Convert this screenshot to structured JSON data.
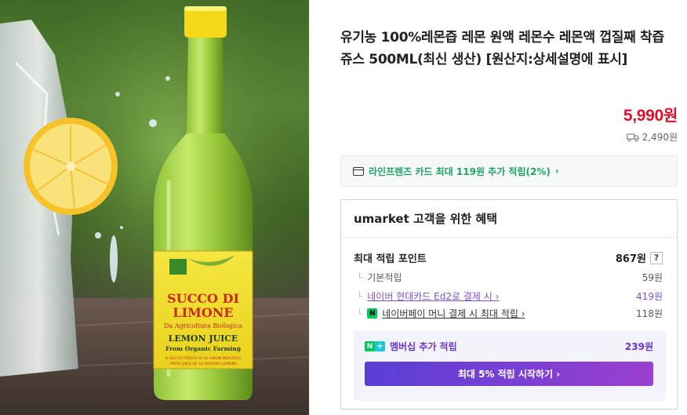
{
  "product": {
    "title": "유기농 100%레몬즙 레몬 원액 레몬수 레몬액 껍질째 착즙 쥬스 500ML(최신 생산) [원산지:상세설명에 표시]",
    "image_label": {
      "brand_line1": "SUCCO DI",
      "brand_line2": "LIMONE",
      "subtitle": "Da Agricoltura Biologica",
      "name": "LEMON JUICE",
      "tagline": "From Organic Farming",
      "fine_print_1": "IL SUCCO FRESCO DI 16 LIMONI BIOLOGICI",
      "fine_print_2": "FRESH JUICE OF 16 ORGANIC LEMONS"
    }
  },
  "pricing": {
    "price": "5,990",
    "price_unit": "원",
    "shipping_icon": "truck-icon",
    "shipping_fee": "2,490원"
  },
  "card_offer": {
    "icon": "credit-card-icon",
    "text": "라인프렌즈 카드 최대 119원 추가 적립(2%)",
    "chevron": "›"
  },
  "benefits": {
    "header": "umarket 고객을 위한 혜택",
    "max_points_label": "최대 적립 포인트",
    "max_points_value": "867원",
    "help": "?",
    "items": [
      {
        "label": "기본적립",
        "value": "59원"
      },
      {
        "label": "네이버 현대카드 Ed2로 결제 시 ›",
        "value": "419원"
      },
      {
        "label": "네이버페이 머니 결제 시 최대 적립 ›",
        "value": "118원"
      }
    ],
    "membership": {
      "badge_n": "N",
      "badge_plus": "+",
      "label": "멤버십 추가 적립",
      "value": "239원",
      "cta": "최대 5% 적립 시작하기 ›"
    }
  },
  "colors": {
    "price_red": "#e0102c",
    "naver_green": "#03c75a",
    "membership_purple": "#6b35c9"
  }
}
